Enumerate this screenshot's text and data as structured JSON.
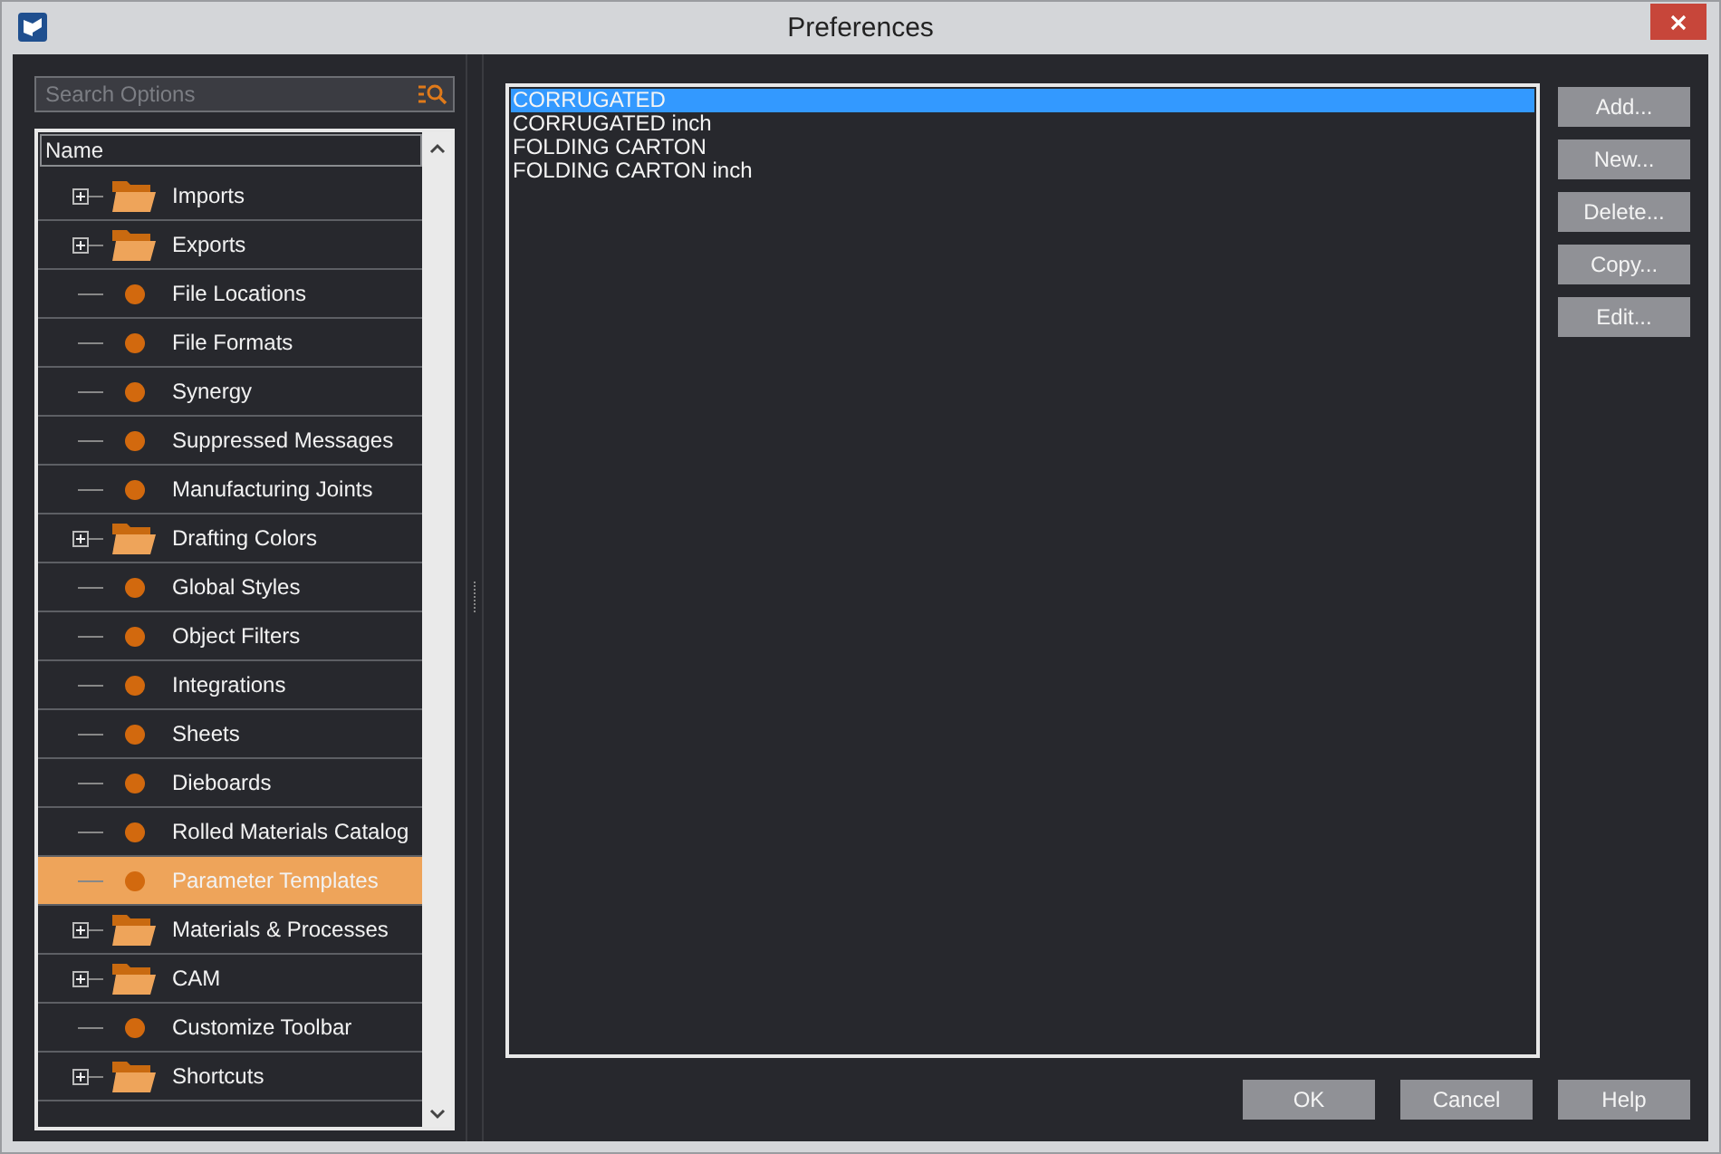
{
  "window": {
    "title": "Preferences"
  },
  "search": {
    "placeholder": "Search Options"
  },
  "tree": {
    "header": "Name",
    "items": [
      {
        "label": "Imports",
        "kind": "folder",
        "selected": false
      },
      {
        "label": "Exports",
        "kind": "folder",
        "selected": false
      },
      {
        "label": "File Locations",
        "kind": "leaf",
        "selected": false
      },
      {
        "label": "File Formats",
        "kind": "leaf",
        "selected": false
      },
      {
        "label": "Synergy",
        "kind": "leaf",
        "selected": false
      },
      {
        "label": "Suppressed Messages",
        "kind": "leaf",
        "selected": false
      },
      {
        "label": "Manufacturing Joints",
        "kind": "leaf",
        "selected": false
      },
      {
        "label": "Drafting Colors",
        "kind": "folder",
        "selected": false
      },
      {
        "label": "Global Styles",
        "kind": "leaf",
        "selected": false
      },
      {
        "label": "Object Filters",
        "kind": "leaf",
        "selected": false
      },
      {
        "label": "Integrations",
        "kind": "leaf",
        "selected": false
      },
      {
        "label": "Sheets",
        "kind": "leaf",
        "selected": false
      },
      {
        "label": "Dieboards",
        "kind": "leaf",
        "selected": false
      },
      {
        "label": "Rolled Materials Catalog",
        "kind": "leaf",
        "selected": false
      },
      {
        "label": "Parameter Templates",
        "kind": "leaf",
        "selected": true
      },
      {
        "label": "Materials & Processes",
        "kind": "folder",
        "selected": false
      },
      {
        "label": "CAM",
        "kind": "folder",
        "selected": false
      },
      {
        "label": "Customize Toolbar",
        "kind": "leaf",
        "selected": false
      },
      {
        "label": "Shortcuts",
        "kind": "folder",
        "selected": false
      }
    ]
  },
  "templates": [
    {
      "label": "CORRUGATED",
      "selected": true
    },
    {
      "label": "CORRUGATED inch",
      "selected": false
    },
    {
      "label": "FOLDING CARTON",
      "selected": false
    },
    {
      "label": "FOLDING CARTON inch",
      "selected": false
    }
  ],
  "side_buttons": [
    "Add...",
    "New...",
    "Delete...",
    "Copy...",
    "Edit..."
  ],
  "footer_buttons": [
    "OK",
    "Cancel",
    "Help"
  ]
}
